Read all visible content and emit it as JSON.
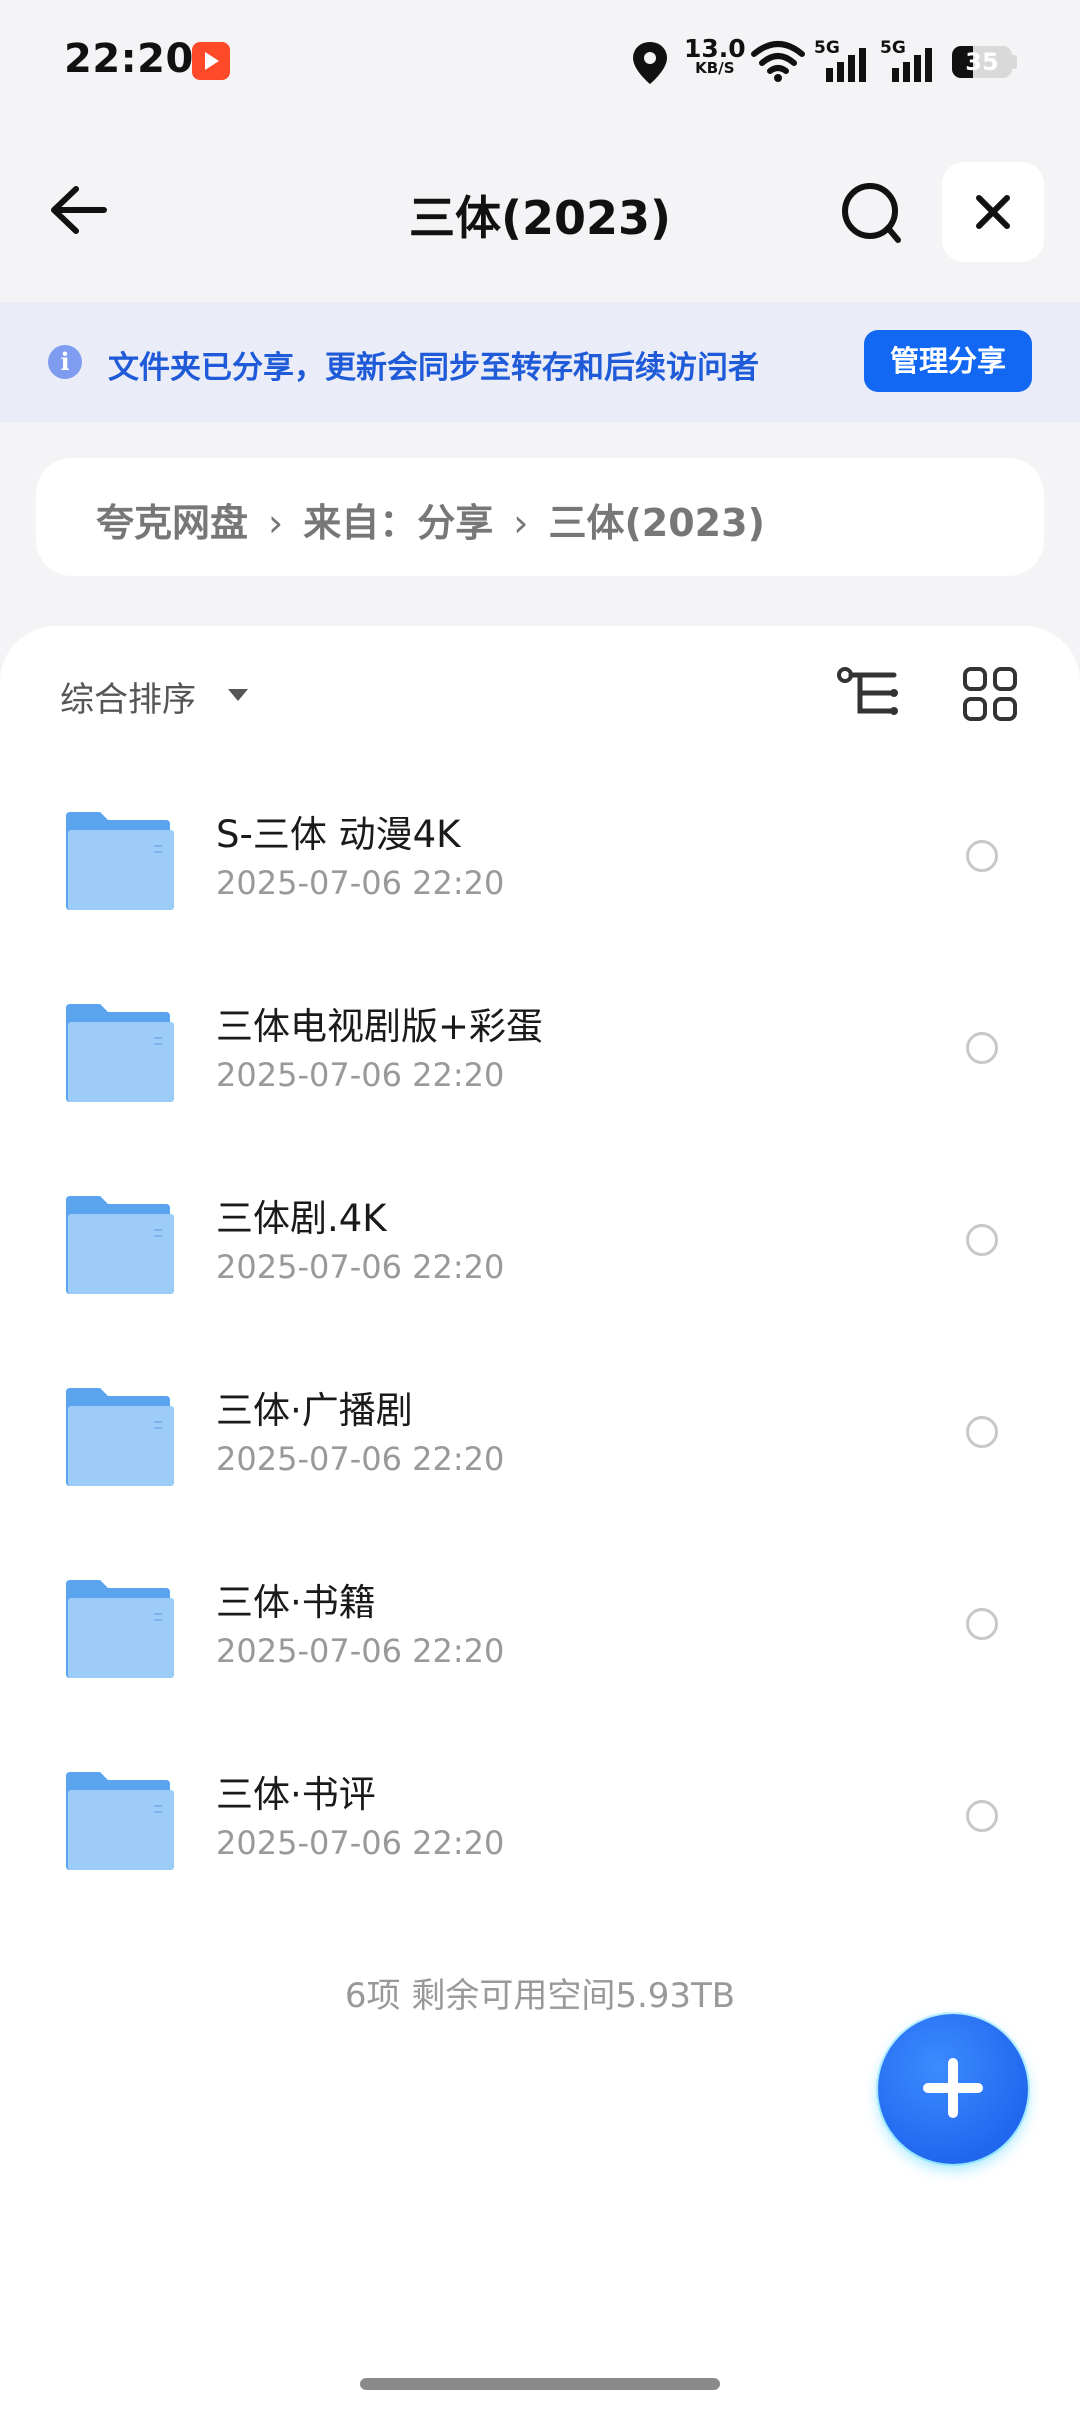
{
  "status_bar": {
    "time": "22:20",
    "net_speed": "13.0",
    "net_unit": "KB/S",
    "signal1_label": "5G",
    "signal2_label": "5G",
    "battery_level": "35",
    "battery_fraction": 0.35,
    "icons": [
      "screen-record-icon",
      "location-icon",
      "wifi-icon",
      "signal-icon",
      "signal-icon",
      "battery-icon"
    ]
  },
  "header": {
    "title": "三体(2023)",
    "back_icon": "arrow-left-icon",
    "search_icon": "search-icon",
    "close_icon": "close-icon"
  },
  "banner": {
    "text": "文件夹已分享，更新会同步至转存和后续访问者",
    "button": "管理分享",
    "icon": "info-icon"
  },
  "breadcrumb": {
    "items": [
      "夸克网盘",
      "来自：分享",
      "三体(2023)"
    ],
    "separator": "›"
  },
  "toolbar": {
    "sort_label": "综合排序",
    "tree_icon": "tree-view-icon",
    "grid_icon": "grid-view-icon"
  },
  "files": [
    {
      "name": "S-三体 动漫4K",
      "date": "2025-07-06 22:20"
    },
    {
      "name": "三体电视剧版+彩蛋",
      "date": "2025-07-06 22:20"
    },
    {
      "name": "三体剧.4K",
      "date": "2025-07-06 22:20"
    },
    {
      "name": "三体·广播剧",
      "date": "2025-07-06 22:20"
    },
    {
      "name": "三体·书籍",
      "date": "2025-07-06 22:20"
    },
    {
      "name": "三体·书评",
      "date": "2025-07-06 22:20"
    }
  ],
  "footer": {
    "summary": "6项 剩余可用空间5.93TB"
  },
  "colors": {
    "accent": "#1268f3",
    "banner_bg": "#eaecf7",
    "banner_text": "#1f5bd9",
    "folder": "#7bbcf5",
    "fab": "#1659e8"
  }
}
